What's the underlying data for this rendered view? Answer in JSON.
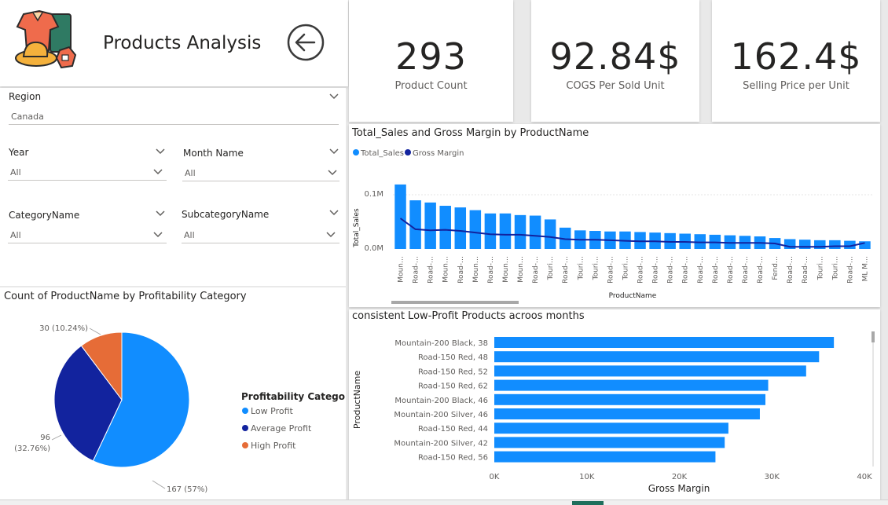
{
  "header": {
    "title": "Products Analysis",
    "back_icon": "back-arrow-icon",
    "logo_icon": "clothing-logo-icon"
  },
  "kpis": [
    {
      "value": "293",
      "label": "Product Count"
    },
    {
      "value": "92.84$",
      "label": "COGS Per Sold Unit"
    },
    {
      "value": "162.4$",
      "label": "Selling Price per Unit"
    }
  ],
  "slicers": {
    "region": {
      "label": "Region",
      "value": "Canada"
    },
    "year": {
      "label": "Year",
      "value": "All"
    },
    "month": {
      "label": "Month Name",
      "value": "All"
    },
    "category": {
      "label": "CategoryName",
      "value": "All"
    },
    "subcategory": {
      "label": "SubcategoryName",
      "value": "All"
    }
  },
  "colors": {
    "blue": "#118dff",
    "navy": "#12239e",
    "orange": "#e66c37",
    "kpi_text": "#252423"
  },
  "chart_data": [
    {
      "type": "pie",
      "title": "Count of ProductName by Profitability Category",
      "legend_title": "Profitability Category",
      "legend_placement": "right",
      "slices": [
        {
          "name": "Low Profit",
          "value": 167,
          "label": "167 (57%)",
          "color": "#118dff"
        },
        {
          "name": "Average Profit",
          "value": 96,
          "label": "96 (32.76%)",
          "color": "#12239e"
        },
        {
          "name": "High Profit",
          "value": 30,
          "label": "30 (10.24%)",
          "color": "#e66c37"
        }
      ]
    },
    {
      "type": "bar",
      "title": "Total_Sales and Gross Margin by ProductName",
      "xlabel": "ProductName",
      "ylabel": "Total_Sales",
      "ytick_labels": [
        "0.0M",
        "0.1M"
      ],
      "ylim": [
        0,
        0.125
      ],
      "legend_placement": "top-left",
      "categories": [
        "Moun…",
        "Road-…",
        "Road-…",
        "Moun…",
        "Road-…",
        "Moun…",
        "Road-…",
        "Moun…",
        "Moun…",
        "Road-…",
        "Touri…",
        "Road-…",
        "Touri…",
        "Touri…",
        "Road-…",
        "Touri…",
        "Road-…",
        "Road-…",
        "Road-…",
        "Road-…",
        "Road-…",
        "Road-…",
        "Road-…",
        "Road-…",
        "Road-…",
        "Fend…",
        "Road-…",
        "Road-…",
        "Touri…",
        "Touri…",
        "Road-…",
        "ML M…"
      ],
      "series": [
        {
          "name": "Total_Sales",
          "type": "bar",
          "color": "#118dff",
          "values": [
            0.118,
            0.089,
            0.085,
            0.079,
            0.076,
            0.071,
            0.065,
            0.065,
            0.062,
            0.061,
            0.054,
            0.039,
            0.034,
            0.033,
            0.032,
            0.032,
            0.031,
            0.03,
            0.029,
            0.028,
            0.027,
            0.026,
            0.025,
            0.024,
            0.023,
            0.02,
            0.018,
            0.017,
            0.016,
            0.016,
            0.015,
            0.014
          ]
        },
        {
          "name": "Gross Margin",
          "type": "line",
          "color": "#12239e",
          "values": [
            0.056,
            0.036,
            0.034,
            0.035,
            0.033,
            0.03,
            0.027,
            0.026,
            0.026,
            0.024,
            0.022,
            0.018,
            0.017,
            0.017,
            0.016,
            0.015,
            0.014,
            0.014,
            0.013,
            0.013,
            0.012,
            0.012,
            0.011,
            0.011,
            0.011,
            0.01,
            0.004,
            0.004,
            0.004,
            0.005,
            0.005,
            0.011
          ]
        }
      ]
    },
    {
      "type": "bar",
      "orientation": "horizontal",
      "title": "consistent Low-Profit Products acroos months",
      "xlabel": "Gross Margin",
      "ylabel": "ProductName",
      "xlim": [
        0,
        40000
      ],
      "xtick_labels": [
        "0K",
        "10K",
        "20K",
        "30K",
        "40K"
      ],
      "categories": [
        "Mountain-200 Black, 38",
        "Road-150 Red, 48",
        "Road-150 Red, 52",
        "Road-150 Red, 62",
        "Mountain-200 Black, 46",
        "Mountain-200 Silver, 46",
        "Road-150 Red, 44",
        "Mountain-200 Silver, 42",
        "Road-150 Red, 56"
      ],
      "values": [
        36700,
        35100,
        33700,
        29600,
        29300,
        28700,
        25300,
        24900,
        23900
      ],
      "color": "#118dff"
    }
  ]
}
